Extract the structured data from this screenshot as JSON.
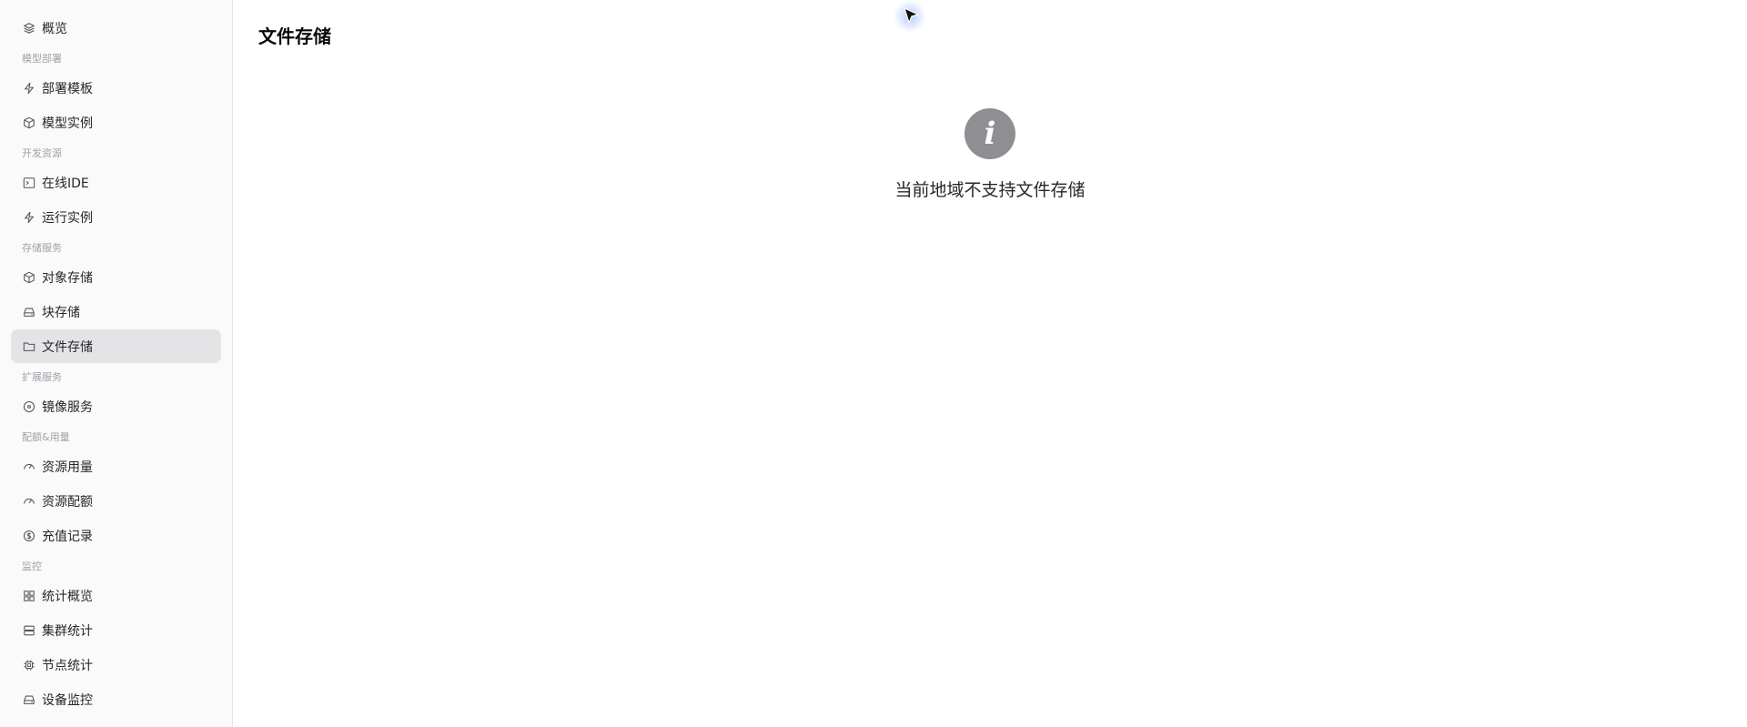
{
  "sidebar": {
    "items": [
      {
        "type": "item",
        "label": "概览",
        "icon": "layers-icon",
        "name": "sidebar-item-overview"
      },
      {
        "type": "section",
        "label": "模型部署"
      },
      {
        "type": "item",
        "label": "部署模板",
        "icon": "bolt-icon",
        "name": "sidebar-item-deploy-template"
      },
      {
        "type": "item",
        "label": "模型实例",
        "icon": "box-icon",
        "name": "sidebar-item-model-instance"
      },
      {
        "type": "section",
        "label": "开发资源"
      },
      {
        "type": "item",
        "label": "在线IDE",
        "icon": "terminal-icon",
        "name": "sidebar-item-online-ide"
      },
      {
        "type": "item",
        "label": "运行实例",
        "icon": "bolt-icon",
        "name": "sidebar-item-running-instance"
      },
      {
        "type": "section",
        "label": "存储服务"
      },
      {
        "type": "item",
        "label": "对象存储",
        "icon": "cube-icon",
        "name": "sidebar-item-object-storage"
      },
      {
        "type": "item",
        "label": "块存储",
        "icon": "hard-drive-icon",
        "name": "sidebar-item-block-storage"
      },
      {
        "type": "item",
        "label": "文件存储",
        "icon": "folder-icon",
        "name": "sidebar-item-file-storage",
        "active": true
      },
      {
        "type": "section",
        "label": "扩展服务"
      },
      {
        "type": "item",
        "label": "镜像服务",
        "icon": "disc-icon",
        "name": "sidebar-item-image-service"
      },
      {
        "type": "section",
        "label": "配额&用量"
      },
      {
        "type": "item",
        "label": "资源用量",
        "icon": "gauge-icon",
        "name": "sidebar-item-resource-usage"
      },
      {
        "type": "item",
        "label": "资源配额",
        "icon": "gauge-icon",
        "name": "sidebar-item-resource-quota"
      },
      {
        "type": "item",
        "label": "充值记录",
        "icon": "dollar-icon",
        "name": "sidebar-item-recharge-records"
      },
      {
        "type": "section",
        "label": "监控"
      },
      {
        "type": "item",
        "label": "统计概览",
        "icon": "grid-icon",
        "name": "sidebar-item-stats-overview"
      },
      {
        "type": "item",
        "label": "集群统计",
        "icon": "server-icon",
        "name": "sidebar-item-cluster-stats"
      },
      {
        "type": "item",
        "label": "节点统计",
        "icon": "chip-icon",
        "name": "sidebar-item-node-stats"
      },
      {
        "type": "item",
        "label": "设备监控",
        "icon": "hard-drive-icon",
        "name": "sidebar-item-device-monitor"
      }
    ]
  },
  "main": {
    "title": "文件存储",
    "empty_icon": "info-icon",
    "empty_glyph": "i",
    "empty_message": "当前地域不支持文件存储"
  },
  "colors": {
    "sidebar_bg": "#fafafa",
    "active_bg": "#e4e4e7",
    "section_label": "#a1a1aa",
    "info_icon_bg": "#8e8e93"
  }
}
